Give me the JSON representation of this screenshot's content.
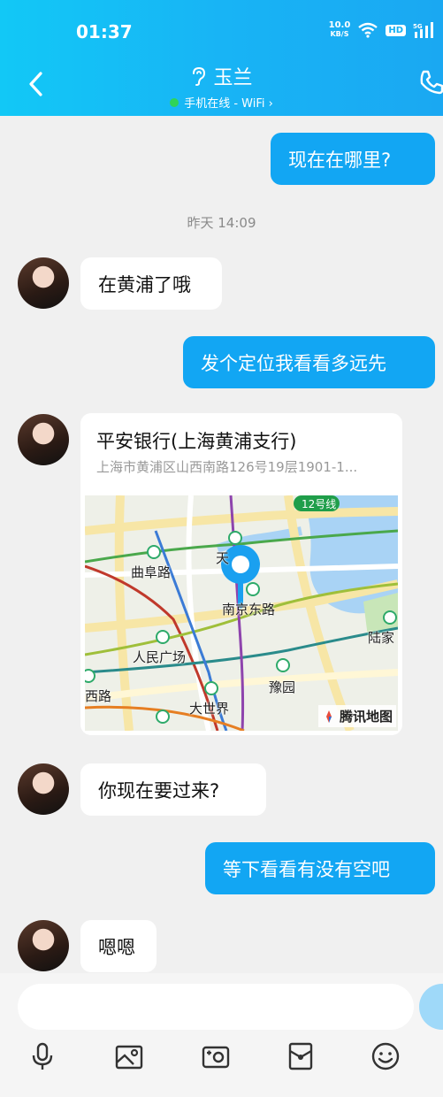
{
  "status_bar": {
    "time": "01:37",
    "net_speed_value": "10.0",
    "net_speed_unit": "KB/S",
    "hd": "HD",
    "signal_label": "5G"
  },
  "header": {
    "contact_name": "玉兰",
    "online_status": "手机在线 - WiFi ›"
  },
  "messages": {
    "m1": "现在在哪里?",
    "time_divider": "昨天 14:09",
    "m2": "在黄浦了哦",
    "m3": "发个定位我看看多远先",
    "m5": "你现在要过来?",
    "m6": "等下看看有没有空吧",
    "m7": "嗯嗯"
  },
  "location_card": {
    "name": "平安银行(上海黄浦支行)",
    "address": "上海市黄浦区山西南路126号19层1901-1...",
    "map_labels": [
      "曲阜路",
      "天",
      "南京东路",
      "人民广场",
      "陆家",
      "西路",
      "豫园",
      "大世界",
      "12号线"
    ],
    "map_brand": "腾讯地图"
  },
  "input": {
    "placeholder": ""
  },
  "colors": {
    "header": "#18b4f5",
    "outgoing_bubble": "#12a6f3",
    "incoming_bubble": "#ffffff",
    "background": "#f0f0f0"
  }
}
